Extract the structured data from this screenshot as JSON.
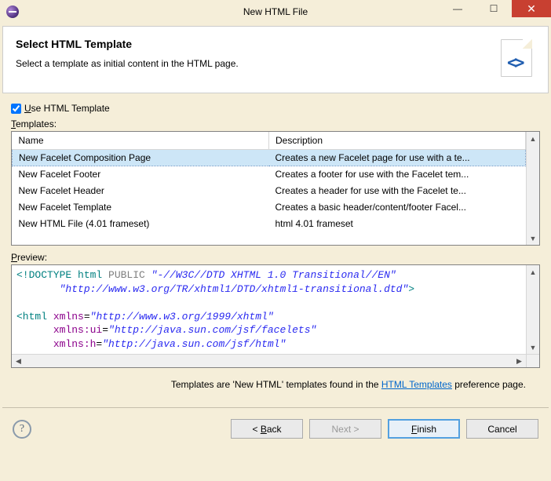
{
  "window": {
    "title": "New HTML File"
  },
  "header": {
    "title": "Select HTML Template",
    "subtitle": "Select a template as initial content in the HTML page."
  },
  "checkbox": {
    "prefix": "U",
    "label": "se HTML Template"
  },
  "templates": {
    "label_prefix": "T",
    "label": "emplates:",
    "columns": {
      "name": "Name",
      "description": "Description"
    },
    "rows": [
      {
        "name": "New Facelet Composition Page",
        "description": "Creates a new Facelet page for use with a te..."
      },
      {
        "name": "New Facelet Footer",
        "description": "Creates a footer for use with the Facelet tem..."
      },
      {
        "name": "New Facelet Header",
        "description": "Creates a header for use with the Facelet te..."
      },
      {
        "name": "New Facelet Template",
        "description": "Creates a basic header/content/footer Facel..."
      },
      {
        "name": "New HTML File (4.01 frameset)",
        "description": "html 4.01 frameset"
      }
    ]
  },
  "preview": {
    "label_prefix": "P",
    "label": "review:"
  },
  "preview_code": {
    "doctype1": "<!DOCTYPE",
    "html_kw": " html ",
    "public_kw": "PUBLIC",
    "pub_id": " \"-//W3C//DTD XHTML 1.0 Transitional//EN\"",
    "sys_id": "\"http://www.w3.org/TR/xhtml1/DTD/xhtml1-transitional.dtd\"",
    "doctype_end": ">",
    "html_open": "<html",
    "xmlns_attr": " xmlns",
    "xmlns_val": "\"http://www.w3.org/1999/xhtml\"",
    "xmlns_ui_attr": "xmlns:ui",
    "xmlns_ui_val": "\"http://java.sun.com/jsf/facelets\"",
    "xmlns_h_attr": "xmlns:h",
    "xmlns_h_val": "\"http://java.sun.com/jsf/html\""
  },
  "hint": {
    "prefix": "Templates are 'New HTML' templates found in the ",
    "link": "HTML Templates",
    "suffix": " preference page."
  },
  "buttons": {
    "back": "< Back",
    "next": "Next >",
    "finish_prefix": "F",
    "finish": "inish",
    "cancel": "Cancel"
  }
}
